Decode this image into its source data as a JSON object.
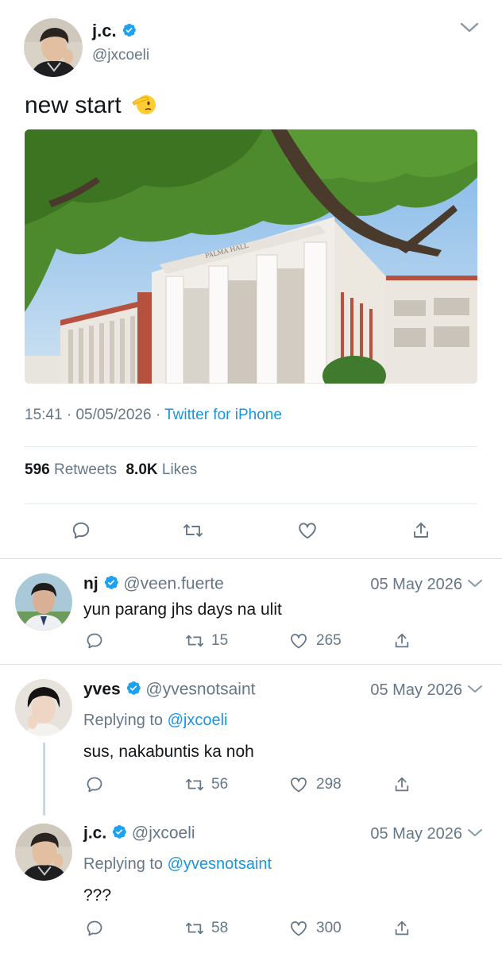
{
  "main_tweet": {
    "name": "j.c.",
    "handle": "@jxcoeli",
    "text": "new start",
    "emoji": "🫡",
    "time": "15:41",
    "date": "05/05/2026",
    "source": "Twitter for iPhone",
    "retweets_count": "596",
    "retweets_label": "Retweets",
    "likes_count": "8.0K",
    "likes_label": "Likes",
    "photo_sign": "PALMA HALL"
  },
  "replies": [
    {
      "name": "nj",
      "handle": "@veen.fuerte",
      "date": "05 May 2026",
      "text": "yun parang jhs days na ulit",
      "retweets": "15",
      "likes": "265"
    },
    {
      "name": "yves",
      "handle": "@yvesnotsaint",
      "date": "05 May 2026",
      "replying_prefix": "Replying to",
      "replying_to": "@jxcoeli",
      "text": "sus, nakabuntis ka noh",
      "retweets": "56",
      "likes": "298"
    },
    {
      "name": "j.c.",
      "handle": "@jxcoeli",
      "date": "05 May 2026",
      "replying_prefix": "Replying to",
      "replying_to": "@yvesnotsaint",
      "text": "???",
      "retweets": "58",
      "likes": "300"
    }
  ],
  "colors": {
    "verified": "#1da1f2",
    "link": "#1b95e0",
    "secondary_text": "#657786",
    "divider": "#e1e8ed"
  },
  "icons": [
    "verified-badge-icon",
    "chevron-down-icon",
    "reply-icon",
    "retweet-icon",
    "like-icon",
    "share-icon"
  ]
}
